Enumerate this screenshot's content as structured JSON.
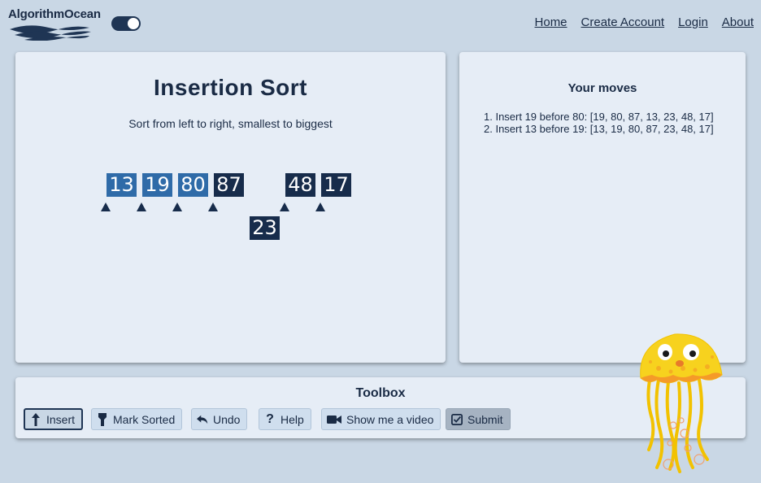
{
  "header": {
    "logo_text": "AlgorithmOcean",
    "nav": [
      "Home",
      "Create Account",
      "Login",
      "About"
    ]
  },
  "main": {
    "title": "Insertion Sort",
    "subtitle": "Sort from left to right, smallest to biggest",
    "boxes": [
      {
        "value": "13",
        "state": "sorted"
      },
      {
        "value": "19",
        "state": "sorted"
      },
      {
        "value": "80",
        "state": "sorted"
      },
      {
        "value": "87",
        "state": "unsorted"
      },
      {
        "value": "23",
        "state": "unsorted",
        "lifted": true
      },
      {
        "value": "48",
        "state": "unsorted"
      },
      {
        "value": "17",
        "state": "unsorted"
      }
    ],
    "colors": {
      "sorted": "#2f6ba8",
      "unsorted": "#172c4b"
    }
  },
  "moves": {
    "title": "Your moves",
    "items": [
      "1. Insert 19 before 80: [19, 80, 87, 13, 23, 48, 17]",
      "2. Insert 13 before 19: [13, 19, 80, 87, 23, 48, 17]"
    ]
  },
  "toolbox": {
    "title": "Toolbox",
    "buttons": [
      {
        "label": "Insert",
        "icon": "arrow-up-icon",
        "active": true
      },
      {
        "label": "Mark Sorted",
        "icon": "flashlight-icon"
      },
      {
        "label": "Undo",
        "icon": "undo-icon"
      },
      {
        "label": "Help",
        "icon": "question-icon"
      },
      {
        "label": "Show me a video",
        "icon": "video-camera-icon"
      },
      {
        "label": "Submit",
        "icon": "checkbox-icon"
      }
    ]
  }
}
